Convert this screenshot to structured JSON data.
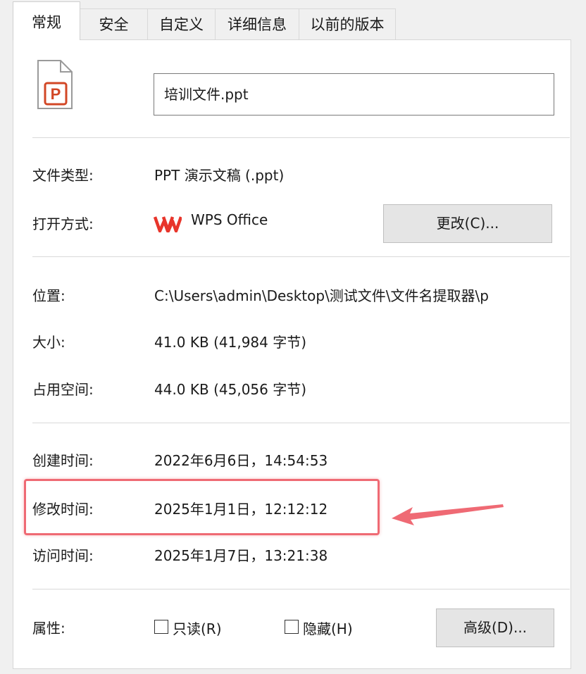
{
  "tabs": [
    "常规",
    "安全",
    "自定义",
    "详细信息",
    "以前的版本"
  ],
  "file": {
    "icon_letter": "P",
    "name": "培训文件.ppt"
  },
  "props": {
    "file_type": {
      "label": "文件类型:",
      "value": "PPT 演示文稿 (.ppt)"
    },
    "open_with": {
      "label": "打开方式:",
      "app": "WPS Office",
      "change_button": "更改(C)..."
    },
    "location": {
      "label": "位置:",
      "value": "C:\\Users\\admin\\Desktop\\测试文件\\文件名提取器\\p"
    },
    "size": {
      "label": "大小:",
      "value": "41.0 KB (41,984 字节)"
    },
    "size_on_disk": {
      "label": "占用空间:",
      "value": "44.0 KB (45,056 字节)"
    },
    "created": {
      "label": "创建时间:",
      "value": "2022年6月6日，14:54:53"
    },
    "modified": {
      "label": "修改时间:",
      "value": "2025年1月1日，12:12:12"
    },
    "accessed": {
      "label": "访问时间:",
      "value": "2025年1月7日，13:21:38"
    }
  },
  "attributes": {
    "label": "属性:",
    "readonly": {
      "label": "只读(R)",
      "checked": false
    },
    "hidden": {
      "label": "隐藏(H)",
      "checked": false
    },
    "advanced_button": "高级(D)..."
  },
  "annotation": {
    "color": "#ef6a74"
  },
  "colors": {
    "wps_red": "#e8352b",
    "ppt_icon": "#d24726"
  }
}
